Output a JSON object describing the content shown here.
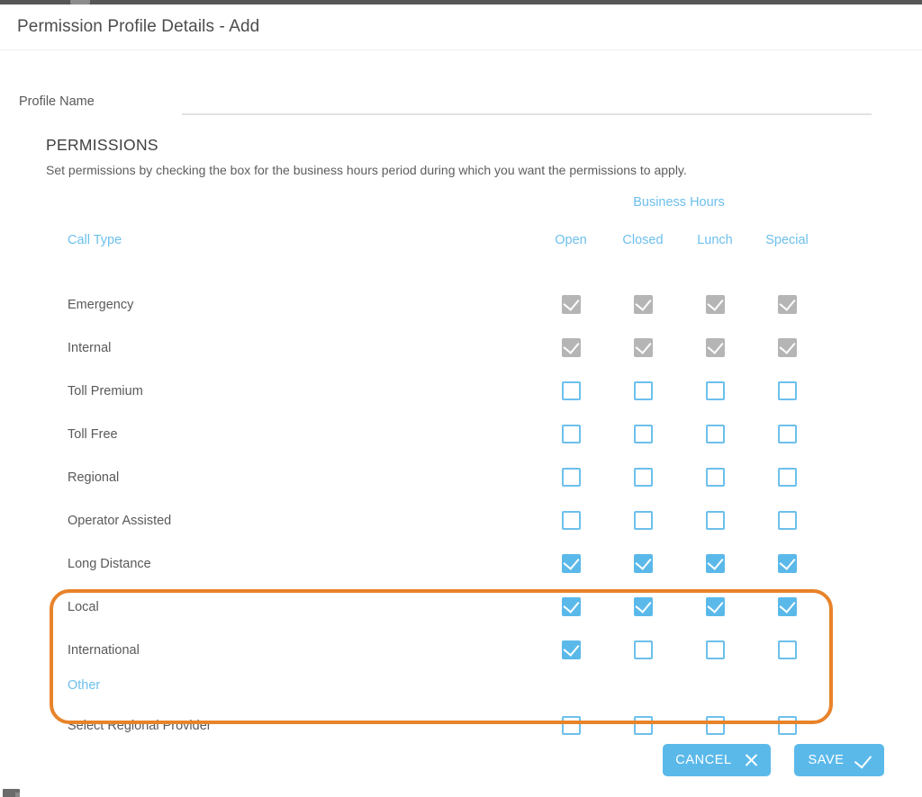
{
  "window": {
    "title": "Permission Profile Details - Add"
  },
  "profile": {
    "name_label": "Profile Name",
    "name_value": "",
    "name_placeholder": ""
  },
  "permissions": {
    "section_title": "PERMISSIONS",
    "section_description": "Set permissions by checking the box for the business hours period during which you want the permissions to apply.",
    "group_header": "Business Hours",
    "call_type_header": "Call Type",
    "columns": [
      "Open",
      "Closed",
      "Lunch",
      "Special"
    ],
    "rows": [
      {
        "label": "Emergency",
        "states": [
          "disabled-checked",
          "disabled-checked",
          "disabled-checked",
          "disabled-checked"
        ]
      },
      {
        "label": "Internal",
        "states": [
          "disabled-checked",
          "disabled-checked",
          "disabled-checked",
          "disabled-checked"
        ]
      },
      {
        "label": "Toll Premium",
        "states": [
          "unchecked",
          "unchecked",
          "unchecked",
          "unchecked"
        ]
      },
      {
        "label": "Toll Free",
        "states": [
          "unchecked",
          "unchecked",
          "unchecked",
          "unchecked"
        ]
      },
      {
        "label": "Regional",
        "states": [
          "unchecked",
          "unchecked",
          "unchecked",
          "unchecked"
        ]
      },
      {
        "label": "Operator Assisted",
        "states": [
          "unchecked",
          "unchecked",
          "unchecked",
          "unchecked"
        ]
      },
      {
        "label": "Long Distance",
        "states": [
          "checked",
          "checked",
          "checked",
          "checked"
        ]
      },
      {
        "label": "Local",
        "states": [
          "checked",
          "checked",
          "checked",
          "checked"
        ]
      },
      {
        "label": "International",
        "states": [
          "checked",
          "unchecked",
          "unchecked",
          "unchecked"
        ]
      }
    ]
  },
  "other": {
    "header": "Other",
    "rows": [
      {
        "label": "Select Regional Provider",
        "states": [
          "unchecked",
          "unchecked",
          "unchecked",
          "unchecked"
        ]
      }
    ]
  },
  "footer": {
    "cancel_label": "CANCEL",
    "cancel_icon": "close-x-icon",
    "save_label": "SAVE",
    "save_icon": "check-icon"
  },
  "highlight": {
    "color": "#e8832a",
    "covers_rows": [
      "Long Distance",
      "Local",
      "International"
    ]
  },
  "colors": {
    "accent_blue": "#5bb9ea",
    "link_blue": "#6dc0ec",
    "disabled_grey": "#b5b5b5",
    "text_grey": "#59595b",
    "highlight_orange": "#e8832a"
  },
  "scrollbar": {
    "orientation": "vertical",
    "thumb_color": "#6fb7ee"
  }
}
